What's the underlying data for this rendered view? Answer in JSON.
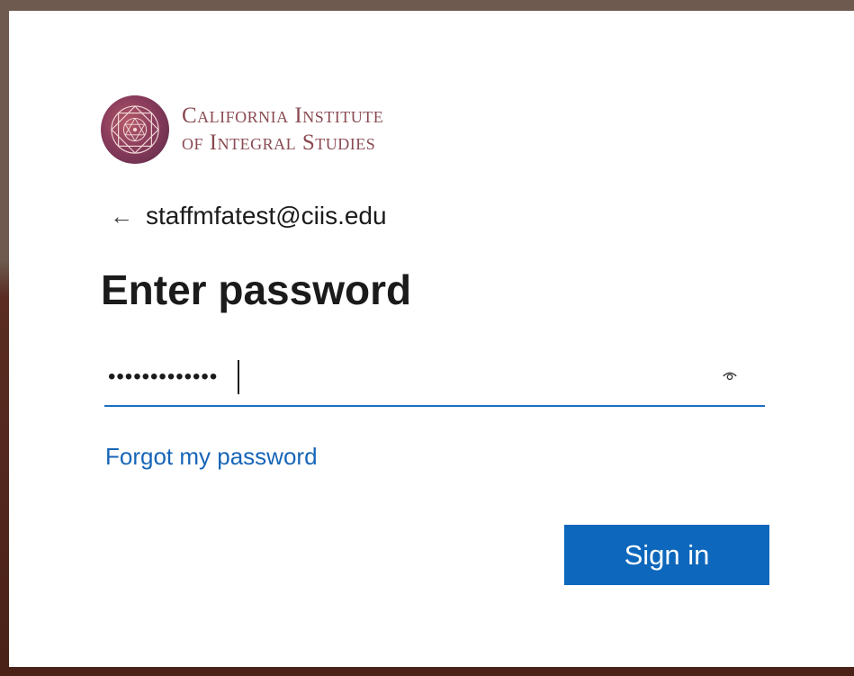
{
  "brand": {
    "line1": "California Institute",
    "line2": "of Integral Studies",
    "logo_icon": "mandala-logo-icon"
  },
  "identity": {
    "back_icon": "back-arrow-icon",
    "back_glyph": "←",
    "email": "staffmfatest@ciis.edu"
  },
  "title": "Enter password",
  "password": {
    "masked_value": "•••••••••••••",
    "reveal_icon": "eye-icon"
  },
  "links": {
    "forgot": "Forgot my password"
  },
  "buttons": {
    "signin": "Sign in"
  },
  "colors": {
    "accent": "#0d67bc",
    "link": "#1766b8",
    "brand_text": "#8a4a52"
  }
}
